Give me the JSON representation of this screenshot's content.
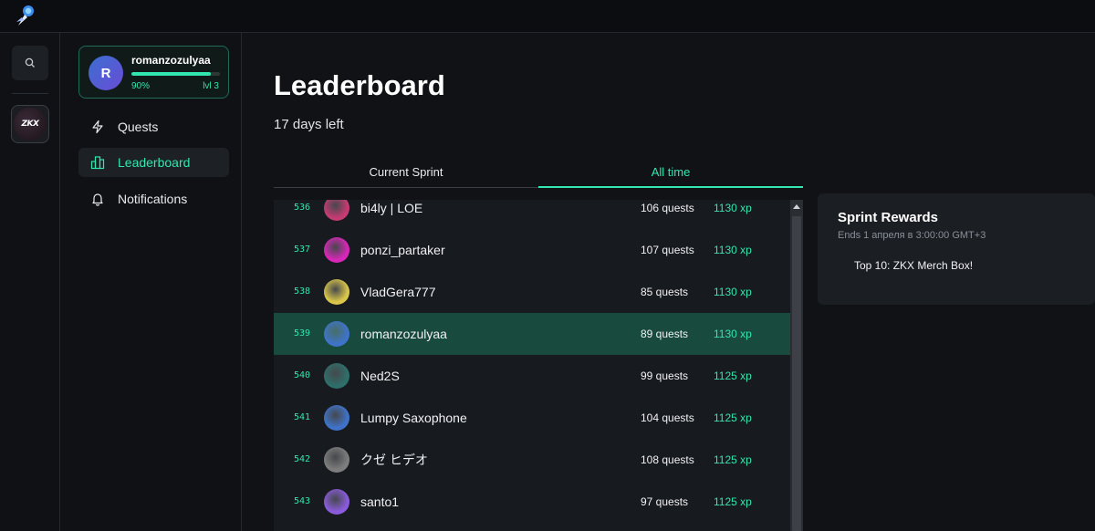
{
  "sidebar": {
    "profile": {
      "initial": "R",
      "username": "romanzozulyaa",
      "progress_label": "90%",
      "progress": 0.9,
      "level": "lvl 3"
    },
    "nav": [
      {
        "label": "Quests",
        "icon": "lightning-icon"
      },
      {
        "label": "Leaderboard",
        "icon": "leaderboard-icon"
      },
      {
        "label": "Notifications",
        "icon": "bell-icon"
      }
    ],
    "active": "Leaderboard"
  },
  "rail": {
    "app_badge": "ZKX"
  },
  "main": {
    "title": "Leaderboard",
    "subtitle": "17 days left",
    "tabs": [
      {
        "label": "Current Sprint"
      },
      {
        "label": "All time"
      }
    ],
    "active_tab": "All time"
  },
  "leaderboard": [
    {
      "rank": "536",
      "name": "bi4ly | LOE",
      "quests": "106 quests",
      "xp": "1130 xp",
      "avatar_color": "#c53b73"
    },
    {
      "rank": "537",
      "name": "ponzi_partaker",
      "quests": "107 quests",
      "xp": "1130 xp",
      "avatar_color": "#d827b8"
    },
    {
      "rank": "538",
      "name": "VladGera777",
      "quests": "85 quests",
      "xp": "1130 xp",
      "avatar_color": "#d9c64a"
    },
    {
      "rank": "539",
      "name": "romanzozulyaa",
      "quests": "89 quests",
      "xp": "1130 xp",
      "avatar_color": "#3f73c9",
      "highlight": true
    },
    {
      "rank": "540",
      "name": "Ned2S",
      "quests": "99 quests",
      "xp": "1125 xp",
      "avatar_color": "#2e6f6a"
    },
    {
      "rank": "541",
      "name": "Lumpy Saxophone",
      "quests": "104 quests",
      "xp": "1125 xp",
      "avatar_color": "#3f73c9"
    },
    {
      "rank": "542",
      "name": "クゼ ヒデオ",
      "quests": "108 quests",
      "xp": "1125 xp",
      "avatar_color": "#7d7d7d"
    },
    {
      "rank": "543",
      "name": "santo1",
      "quests": "97 quests",
      "xp": "1125 xp",
      "avatar_color": "#8a5cdb"
    }
  ],
  "rewards": {
    "title": "Sprint Rewards",
    "subtitle": "Ends 1 апреля в 3:00:00 GMT+3",
    "items": [
      "Top 10: ZKX Merch Box!"
    ]
  },
  "colors": {
    "accent": "#31e6b0",
    "highlight_row": "#184a3e",
    "background": "#101216"
  }
}
